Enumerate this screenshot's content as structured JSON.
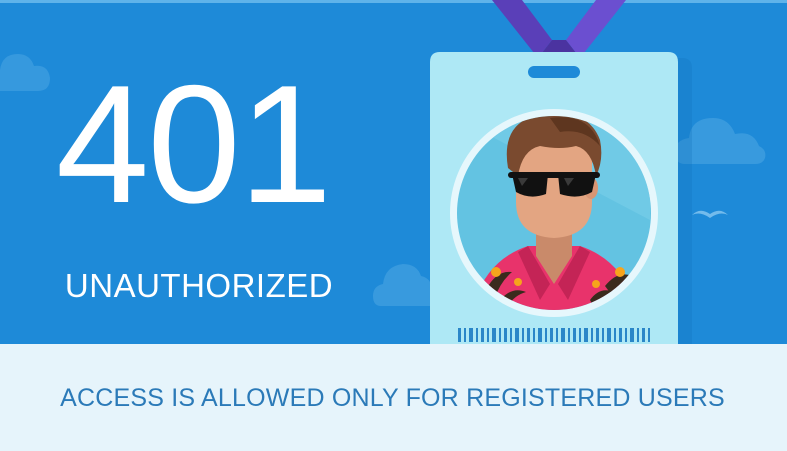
{
  "error": {
    "code": "401",
    "title": "UNAUTHORIZED",
    "message": "ACCESS IS ALLOWED ONLY FOR REGISTERED USERS"
  },
  "illustration": {
    "subject": "id-badge-with-person-in-sunglasses-and-hawaiian-shirt",
    "lanyard_color": "#5a3fb8",
    "badge_color": "#aee8f5",
    "hair_color": "#7a4a2f",
    "shirt_color": "#e8336b"
  },
  "colors": {
    "hero_background": "#1e8ad8",
    "footer_background": "#e6f4fb",
    "footer_text": "#2b7ab8",
    "hero_text": "#ffffff"
  }
}
